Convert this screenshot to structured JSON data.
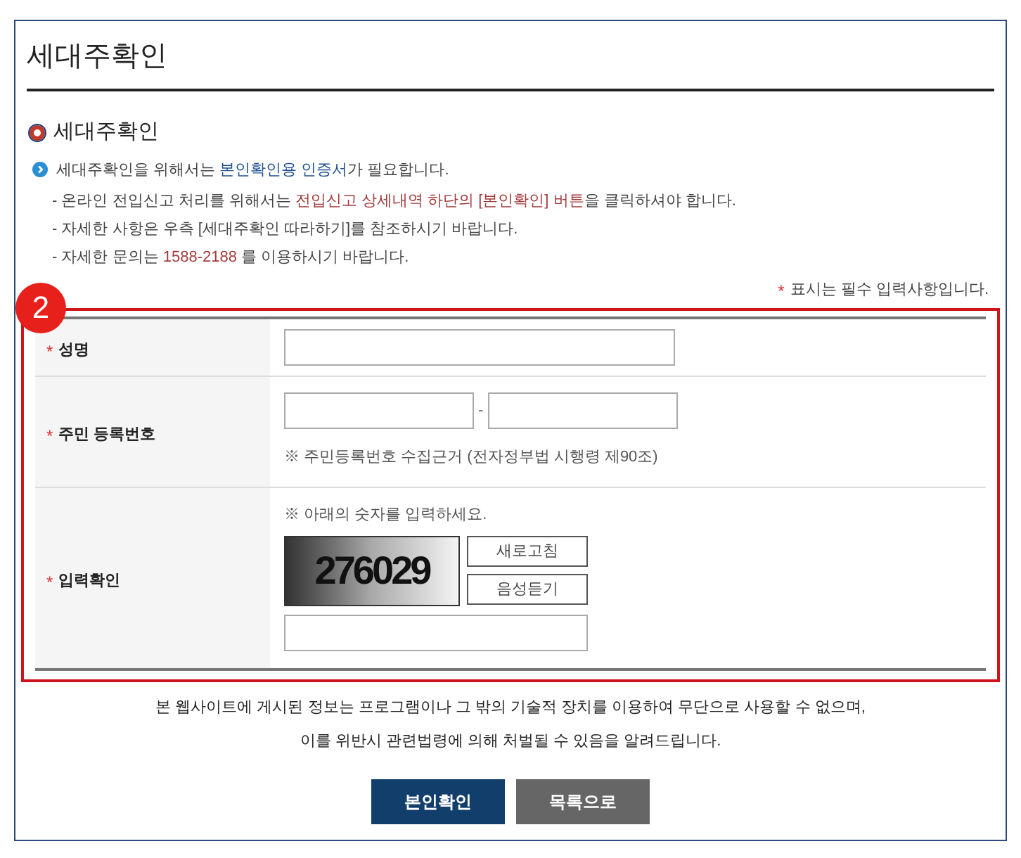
{
  "page_title": "세대주확인",
  "section_title": "세대주확인",
  "intro": [
    {
      "text": "세대주확인을 위해서는 ",
      "highlight": false
    },
    {
      "text": "본인확인용 인증서",
      "highlight": true
    },
    {
      "text": "가 필요합니다.",
      "highlight": false
    }
  ],
  "notes": [
    [
      {
        "text": "- 온라인 전입신고 처리를 위해서는 ",
        "highlight": false
      },
      {
        "text": "전입신고 상세내역 하단의 [본인확인] 버튼",
        "highlight": true
      },
      {
        "text": "을 클릭하셔야 합니다.",
        "highlight": false
      }
    ],
    [
      {
        "text": "- 자세한 사항은 우측 [세대주확인 따라하기]를 참조하시기 바랍니다.",
        "highlight": false
      }
    ],
    [
      {
        "text": "- 자세한 문의는 ",
        "highlight": false
      },
      {
        "text": "1588-2188",
        "highlight": true
      },
      {
        "text": " 를 이용하시기 바랍니다.",
        "highlight": false
      }
    ]
  ],
  "required_mark": "*",
  "required_note": "표시는 필수 입력사항입니다.",
  "step_badge": "2",
  "rows": [
    {
      "kind": "name",
      "label": "성명",
      "required": true
    },
    {
      "kind": "resident_number",
      "label": "주민 등록번호",
      "required": true,
      "separator": "-",
      "hint": "※ 주민등록번호 수집근거 (전자정부법 시행령 제90조)"
    },
    {
      "kind": "captcha",
      "label": "입력확인",
      "required": true,
      "hint": "※ 아래의 숫자를 입력하세요.",
      "captcha": "276029",
      "buttons": [
        "새로고침",
        "음성듣기"
      ]
    }
  ],
  "disclaimer": [
    "본 웹사이트에 게시된 정보는 프로그램이나 그 밖의 기술적 장치를 이용하여 무단으로 사용할 수 없으며,",
    "이를 위반시 관련법령에 의해 처벌될 수 있음을 알려드립니다."
  ],
  "buttons": [
    {
      "label": "본인확인",
      "kind": "primary"
    },
    {
      "label": "목록으로",
      "kind": "secondary"
    }
  ]
}
